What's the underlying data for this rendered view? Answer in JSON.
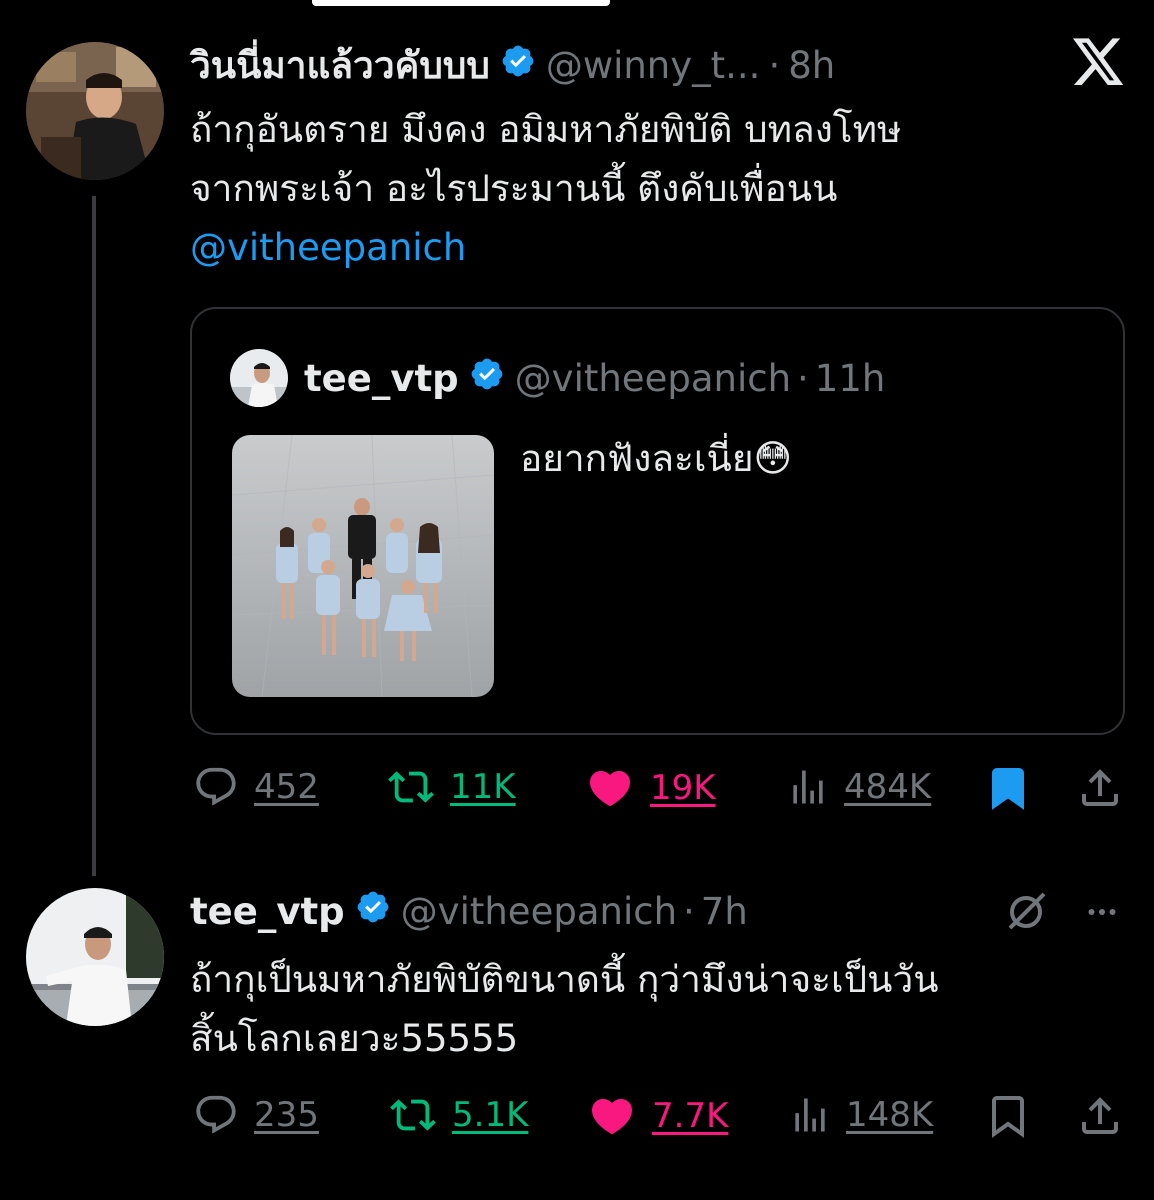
{
  "colors": {
    "background": "#000000",
    "text": "#e7e9ea",
    "muted": "#71767b",
    "link": "#1d9bf0",
    "retweet": "#00ba7c",
    "like": "#f91880",
    "bookmark": "#1d9bf0"
  },
  "tweet1": {
    "display_name": "วินนี่มาแล้ววคับบบ",
    "handle": "@winny_t...",
    "dot": "·",
    "time": "8h",
    "text_line1": "ถ้ากุอันตราย มึงคง อมิมหาภัยพิบัติ บทลงโทษ",
    "text_line2": "จากพระเจ้า อะไรประมานนี้ ตึงคับเพื่อนน",
    "mention": "@vitheepanich",
    "quote": {
      "display_name": "tee_vtp",
      "handle": "@vitheepanich",
      "dot": "·",
      "time": "11h",
      "text": "อยากฟังละเนี่ย",
      "emoji": "😳"
    },
    "actions": {
      "replies": "452",
      "retweets": "11K",
      "likes": "19K",
      "views": "484K"
    }
  },
  "tweet2": {
    "display_name": "tee_vtp",
    "handle": "@vitheepanich",
    "dot": "·",
    "time": "7h",
    "text_line1": "ถ้ากุเป็นมหาภัยพิบัติขนาดนี้ กุว่ามึงน่าจะเป็นวัน",
    "text_line2": "สิ้นโลกเลยวะ55555",
    "actions": {
      "replies": "235",
      "retweets": "5.1K",
      "likes": "7.7K",
      "views": "148K"
    }
  },
  "icons": [
    "x-logo-icon",
    "verified-badge-icon",
    "reply-icon",
    "retweet-icon",
    "like-icon",
    "views-icon",
    "bookmark-icon",
    "share-icon",
    "grok-icon",
    "more-icon"
  ]
}
